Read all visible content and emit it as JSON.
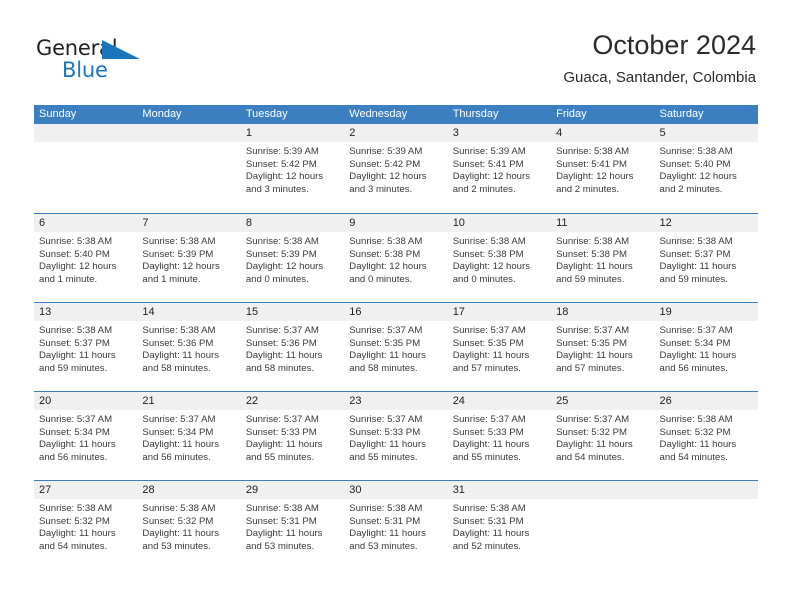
{
  "brand": {
    "name_dark": "General",
    "name_blue": "Blue",
    "flag_color": "#1b75bc",
    "text_color": "#231f20"
  },
  "header": {
    "title": "October 2024",
    "subtitle": "Guaca, Santander, Colombia"
  },
  "theme": {
    "header_blue": "#3b7fc0",
    "day_band_gray": "#f0f0f0",
    "text": "#222222"
  },
  "weekday_headers": [
    "Sunday",
    "Monday",
    "Tuesday",
    "Wednesday",
    "Thursday",
    "Friday",
    "Saturday"
  ],
  "labels": {
    "sunrise_prefix": "Sunrise: ",
    "sunset_prefix": "Sunset: ",
    "daylight_prefix": "Daylight: "
  },
  "weeks": [
    [
      {
        "day": "",
        "empty": true
      },
      {
        "day": "",
        "empty": true
      },
      {
        "day": "1",
        "sunrise": "Sunrise: 5:39 AM",
        "sunset": "Sunset: 5:42 PM",
        "daylight_1": "Daylight: 12 hours",
        "daylight_2": "and 3 minutes."
      },
      {
        "day": "2",
        "sunrise": "Sunrise: 5:39 AM",
        "sunset": "Sunset: 5:42 PM",
        "daylight_1": "Daylight: 12 hours",
        "daylight_2": "and 3 minutes."
      },
      {
        "day": "3",
        "sunrise": "Sunrise: 5:39 AM",
        "sunset": "Sunset: 5:41 PM",
        "daylight_1": "Daylight: 12 hours",
        "daylight_2": "and 2 minutes."
      },
      {
        "day": "4",
        "sunrise": "Sunrise: 5:38 AM",
        "sunset": "Sunset: 5:41 PM",
        "daylight_1": "Daylight: 12 hours",
        "daylight_2": "and 2 minutes."
      },
      {
        "day": "5",
        "sunrise": "Sunrise: 5:38 AM",
        "sunset": "Sunset: 5:40 PM",
        "daylight_1": "Daylight: 12 hours",
        "daylight_2": "and 2 minutes."
      }
    ],
    [
      {
        "day": "6",
        "sunrise": "Sunrise: 5:38 AM",
        "sunset": "Sunset: 5:40 PM",
        "daylight_1": "Daylight: 12 hours",
        "daylight_2": "and 1 minute."
      },
      {
        "day": "7",
        "sunrise": "Sunrise: 5:38 AM",
        "sunset": "Sunset: 5:39 PM",
        "daylight_1": "Daylight: 12 hours",
        "daylight_2": "and 1 minute."
      },
      {
        "day": "8",
        "sunrise": "Sunrise: 5:38 AM",
        "sunset": "Sunset: 5:39 PM",
        "daylight_1": "Daylight: 12 hours",
        "daylight_2": "and 0 minutes."
      },
      {
        "day": "9",
        "sunrise": "Sunrise: 5:38 AM",
        "sunset": "Sunset: 5:38 PM",
        "daylight_1": "Daylight: 12 hours",
        "daylight_2": "and 0 minutes."
      },
      {
        "day": "10",
        "sunrise": "Sunrise: 5:38 AM",
        "sunset": "Sunset: 5:38 PM",
        "daylight_1": "Daylight: 12 hours",
        "daylight_2": "and 0 minutes."
      },
      {
        "day": "11",
        "sunrise": "Sunrise: 5:38 AM",
        "sunset": "Sunset: 5:38 PM",
        "daylight_1": "Daylight: 11 hours",
        "daylight_2": "and 59 minutes."
      },
      {
        "day": "12",
        "sunrise": "Sunrise: 5:38 AM",
        "sunset": "Sunset: 5:37 PM",
        "daylight_1": "Daylight: 11 hours",
        "daylight_2": "and 59 minutes."
      }
    ],
    [
      {
        "day": "13",
        "sunrise": "Sunrise: 5:38 AM",
        "sunset": "Sunset: 5:37 PM",
        "daylight_1": "Daylight: 11 hours",
        "daylight_2": "and 59 minutes."
      },
      {
        "day": "14",
        "sunrise": "Sunrise: 5:38 AM",
        "sunset": "Sunset: 5:36 PM",
        "daylight_1": "Daylight: 11 hours",
        "daylight_2": "and 58 minutes."
      },
      {
        "day": "15",
        "sunrise": "Sunrise: 5:37 AM",
        "sunset": "Sunset: 5:36 PM",
        "daylight_1": "Daylight: 11 hours",
        "daylight_2": "and 58 minutes."
      },
      {
        "day": "16",
        "sunrise": "Sunrise: 5:37 AM",
        "sunset": "Sunset: 5:35 PM",
        "daylight_1": "Daylight: 11 hours",
        "daylight_2": "and 58 minutes."
      },
      {
        "day": "17",
        "sunrise": "Sunrise: 5:37 AM",
        "sunset": "Sunset: 5:35 PM",
        "daylight_1": "Daylight: 11 hours",
        "daylight_2": "and 57 minutes."
      },
      {
        "day": "18",
        "sunrise": "Sunrise: 5:37 AM",
        "sunset": "Sunset: 5:35 PM",
        "daylight_1": "Daylight: 11 hours",
        "daylight_2": "and 57 minutes."
      },
      {
        "day": "19",
        "sunrise": "Sunrise: 5:37 AM",
        "sunset": "Sunset: 5:34 PM",
        "daylight_1": "Daylight: 11 hours",
        "daylight_2": "and 56 minutes."
      }
    ],
    [
      {
        "day": "20",
        "sunrise": "Sunrise: 5:37 AM",
        "sunset": "Sunset: 5:34 PM",
        "daylight_1": "Daylight: 11 hours",
        "daylight_2": "and 56 minutes."
      },
      {
        "day": "21",
        "sunrise": "Sunrise: 5:37 AM",
        "sunset": "Sunset: 5:34 PM",
        "daylight_1": "Daylight: 11 hours",
        "daylight_2": "and 56 minutes."
      },
      {
        "day": "22",
        "sunrise": "Sunrise: 5:37 AM",
        "sunset": "Sunset: 5:33 PM",
        "daylight_1": "Daylight: 11 hours",
        "daylight_2": "and 55 minutes."
      },
      {
        "day": "23",
        "sunrise": "Sunrise: 5:37 AM",
        "sunset": "Sunset: 5:33 PM",
        "daylight_1": "Daylight: 11 hours",
        "daylight_2": "and 55 minutes."
      },
      {
        "day": "24",
        "sunrise": "Sunrise: 5:37 AM",
        "sunset": "Sunset: 5:33 PM",
        "daylight_1": "Daylight: 11 hours",
        "daylight_2": "and 55 minutes."
      },
      {
        "day": "25",
        "sunrise": "Sunrise: 5:37 AM",
        "sunset": "Sunset: 5:32 PM",
        "daylight_1": "Daylight: 11 hours",
        "daylight_2": "and 54 minutes."
      },
      {
        "day": "26",
        "sunrise": "Sunrise: 5:38 AM",
        "sunset": "Sunset: 5:32 PM",
        "daylight_1": "Daylight: 11 hours",
        "daylight_2": "and 54 minutes."
      }
    ],
    [
      {
        "day": "27",
        "sunrise": "Sunrise: 5:38 AM",
        "sunset": "Sunset: 5:32 PM",
        "daylight_1": "Daylight: 11 hours",
        "daylight_2": "and 54 minutes."
      },
      {
        "day": "28",
        "sunrise": "Sunrise: 5:38 AM",
        "sunset": "Sunset: 5:32 PM",
        "daylight_1": "Daylight: 11 hours",
        "daylight_2": "and 53 minutes."
      },
      {
        "day": "29",
        "sunrise": "Sunrise: 5:38 AM",
        "sunset": "Sunset: 5:31 PM",
        "daylight_1": "Daylight: 11 hours",
        "daylight_2": "and 53 minutes."
      },
      {
        "day": "30",
        "sunrise": "Sunrise: 5:38 AM",
        "sunset": "Sunset: 5:31 PM",
        "daylight_1": "Daylight: 11 hours",
        "daylight_2": "and 53 minutes."
      },
      {
        "day": "31",
        "sunrise": "Sunrise: 5:38 AM",
        "sunset": "Sunset: 5:31 PM",
        "daylight_1": "Daylight: 11 hours",
        "daylight_2": "and 52 minutes."
      },
      {
        "day": "",
        "empty": true
      },
      {
        "day": "",
        "empty": true
      }
    ]
  ]
}
